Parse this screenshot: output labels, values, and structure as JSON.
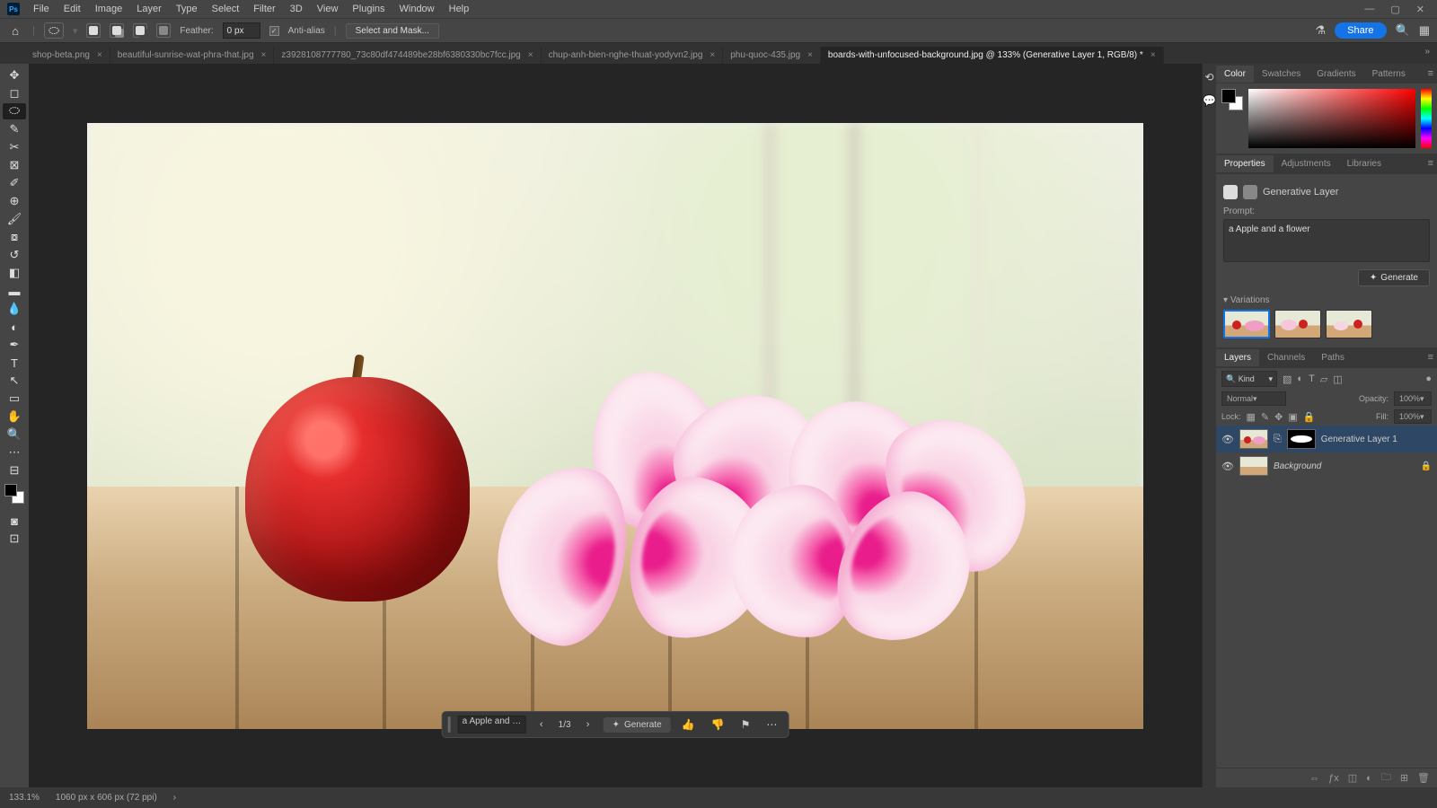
{
  "menu": [
    "File",
    "Edit",
    "Image",
    "Layer",
    "Type",
    "Select",
    "Filter",
    "3D",
    "View",
    "Plugins",
    "Window",
    "Help"
  ],
  "options": {
    "feather_label": "Feather:",
    "feather_value": "0 px",
    "antialias_label": "Anti-alias",
    "selectmask_label": "Select and Mask...",
    "share_label": "Share"
  },
  "tabs": [
    {
      "label": "shop-beta.png",
      "active": false
    },
    {
      "label": "beautiful-sunrise-wat-phra-that.jpg",
      "active": false
    },
    {
      "label": "z3928108777780_73c80df474489be28bf6380330bc7fcc.jpg",
      "active": false
    },
    {
      "label": "chup-anh-bien-nghe-thuat-yodyvn2.jpg",
      "active": false
    },
    {
      "label": "phu-quoc-435.jpg",
      "active": false
    },
    {
      "label": "boards-with-unfocused-background.jpg @ 133% (Generative Layer 1, RGB/8) *",
      "active": true
    }
  ],
  "taskbar": {
    "prompt_short": "a Apple and a flo...",
    "count": "1/3",
    "generate_label": "Generate"
  },
  "color_tabs": [
    "Color",
    "Swatches",
    "Gradients",
    "Patterns"
  ],
  "prop_tabs": [
    "Properties",
    "Adjustments",
    "Libraries"
  ],
  "properties": {
    "type_label": "Generative Layer",
    "prompt_label": "Prompt:",
    "prompt_value": "a Apple and a flower",
    "generate_label": "Generate",
    "variations_label": "Variations"
  },
  "layers_tabs": [
    "Layers",
    "Channels",
    "Paths"
  ],
  "layers": {
    "kind_label": "Kind",
    "blend_mode": "Normal",
    "opacity_label": "Opacity:",
    "opacity_value": "100%",
    "lock_label": "Lock:",
    "fill_label": "Fill:",
    "fill_value": "100%",
    "items": [
      {
        "name": "Generative Layer 1",
        "active": true,
        "mask": true,
        "locked": false
      },
      {
        "name": "Background",
        "active": false,
        "mask": false,
        "locked": true,
        "italic": true
      }
    ]
  },
  "status": {
    "zoom": "133.1%",
    "doc": "1060 px x 606 px (72 ppi)"
  }
}
